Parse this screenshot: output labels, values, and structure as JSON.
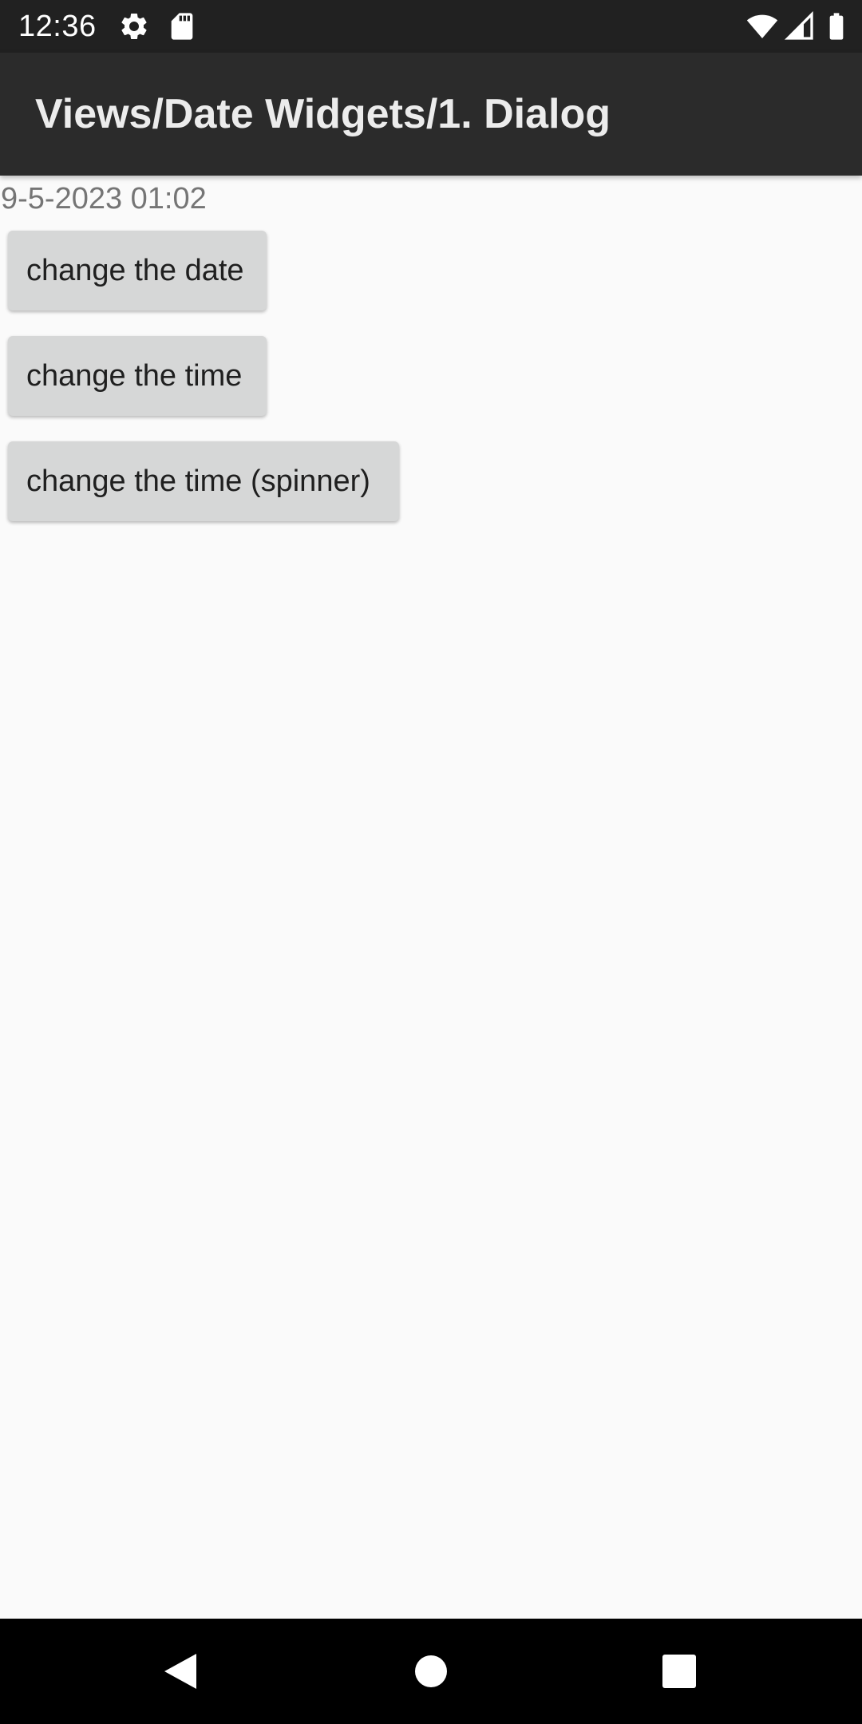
{
  "status_bar": {
    "time": "12:36",
    "icons": [
      "settings-icon",
      "sd-card-icon",
      "wifi-icon",
      "signal-icon",
      "battery-icon"
    ]
  },
  "app_bar": {
    "title": "Views/Date Widgets/1. Dialog"
  },
  "content": {
    "datetime_value": "9-5-2023 01:02",
    "buttons": {
      "change_date": "change the date",
      "change_time": "change the time",
      "change_time_spinner": "change the time (spinner)"
    }
  },
  "nav_bar": {
    "icons": [
      "back-icon",
      "home-icon",
      "recents-icon"
    ]
  },
  "colors": {
    "status_bar_bg": "#212121",
    "app_bar_bg": "#2b2b2b",
    "background": "#fafafa",
    "button_bg": "#d6d7d7",
    "label_text": "#757575"
  }
}
